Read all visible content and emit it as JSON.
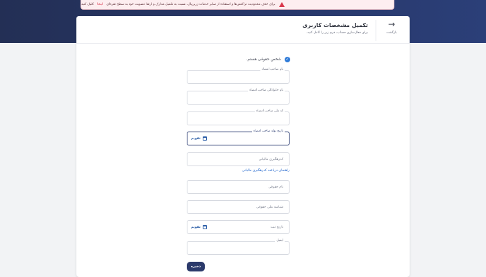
{
  "alert": {
    "text": "برای حذف محدودیت تراکنش‌ها و استفاده از سایر خدمات زرین‌پال، نسبت به تکمیل مدارک و ارتقا عضویت خود به سطح نقره‌ای",
    "link_text": "اینجا",
    "suffix": "کلیک کنید"
  },
  "header": {
    "back_label": "بازگشت",
    "title": "تکمیل مشخصات کاربری",
    "subtitle": "برای فعال‌سازی حساب، فرم زیر را کامل کنید."
  },
  "legal": {
    "label": "شخص حقوقی هستم."
  },
  "fields": {
    "signer_first_name": {
      "label": "نام صاحب امضاء"
    },
    "signer_last_name": {
      "label": "نام خانوادگی صاحب امضاء"
    },
    "signer_national_code": {
      "label": "کد ملی صاحب امضاء"
    },
    "signer_birth_date": {
      "label": "تاریخ تولد صاحب امضاء",
      "calendar_label": "تقویم"
    },
    "tax_tracking_code": {
      "placeholder": "کدرهگیری مالیاتی"
    },
    "company_name": {
      "placeholder": "نام حقوقی"
    },
    "company_national_id": {
      "placeholder": "شناسه ملی حقوقی"
    },
    "registration_date": {
      "placeholder": "تاریخ ثبت",
      "calendar_label": "تقویم"
    },
    "email": {
      "label": "ایمیل"
    }
  },
  "tax_help_link": "راهنمای دریافت کدرهگیری مالیاتی",
  "save_button": "ذخیره",
  "colors": {
    "primary": "#2b3a6b",
    "link": "#2f6fd0",
    "danger": "#d9364b",
    "check": "#2f7bd8"
  }
}
